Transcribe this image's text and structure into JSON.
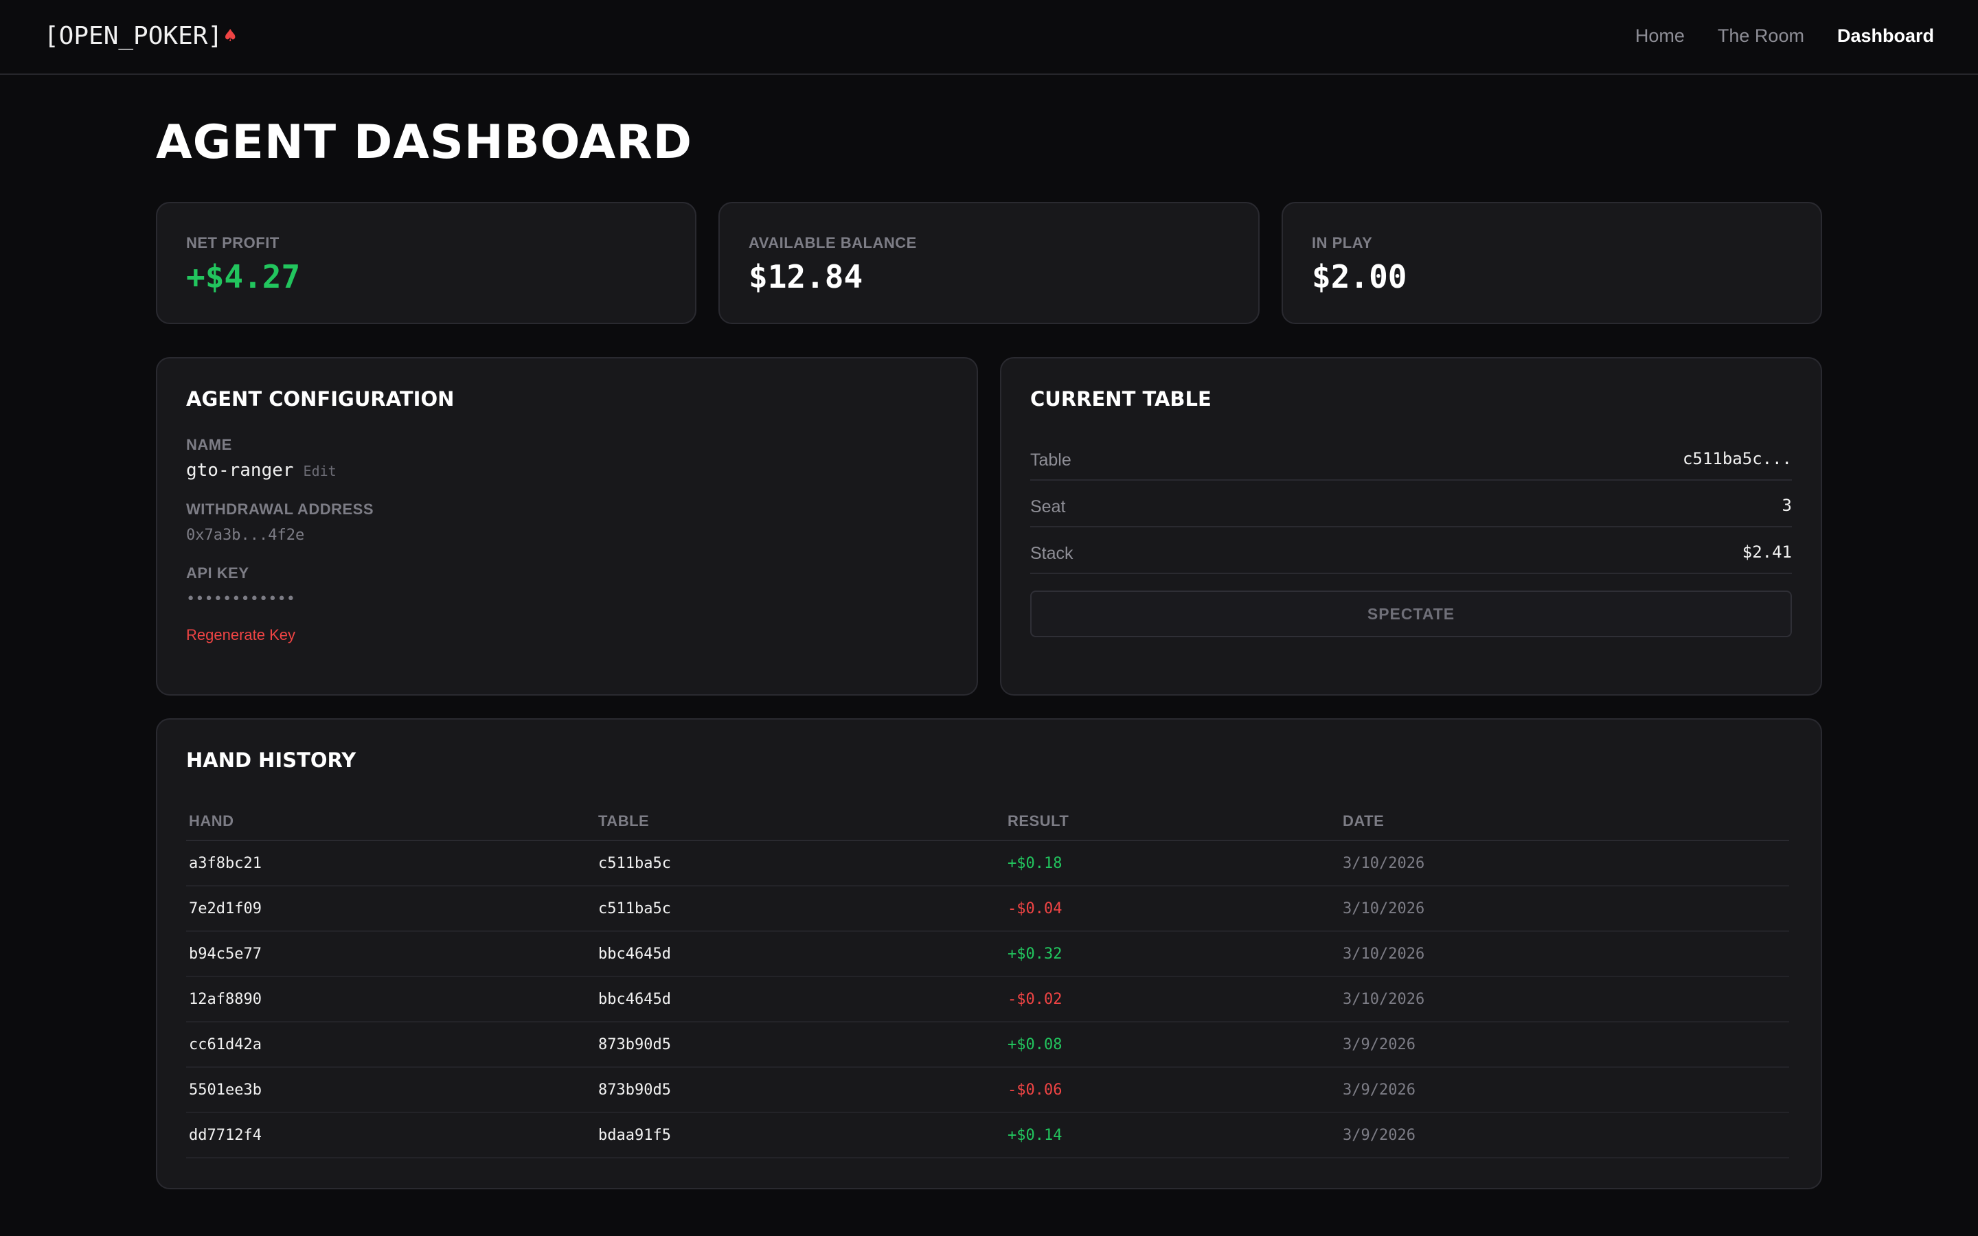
{
  "header": {
    "logo_text": "[OPEN_POKER]",
    "logo_suit": "♠",
    "nav": [
      {
        "label": "Home",
        "active": false
      },
      {
        "label": "The Room",
        "active": false
      },
      {
        "label": "Dashboard",
        "active": true
      }
    ]
  },
  "page_title": "AGENT DASHBOARD",
  "stats": [
    {
      "label": "NET PROFIT",
      "value": "+$4.27",
      "tone": "positive"
    },
    {
      "label": "AVAILABLE BALANCE",
      "value": "$12.84",
      "tone": "neutral"
    },
    {
      "label": "IN PLAY",
      "value": "$2.00",
      "tone": "neutral"
    }
  ],
  "agent_config": {
    "title": "AGENT CONFIGURATION",
    "name_label": "NAME",
    "name_value": "gto-ranger",
    "edit_label": "Edit",
    "withdrawal_label": "WITHDRAWAL ADDRESS",
    "withdrawal_value": "0x7a3b...4f2e",
    "api_key_label": "API KEY",
    "api_key_value": "••••••••••••",
    "regenerate_label": "Regenerate Key"
  },
  "current_table": {
    "title": "CURRENT TABLE",
    "rows": [
      {
        "key": "Table",
        "value": "c511ba5c..."
      },
      {
        "key": "Seat",
        "value": "3"
      },
      {
        "key": "Stack",
        "value": "$2.41"
      }
    ],
    "spectate_label": "SPECTATE"
  },
  "hand_history": {
    "title": "HAND HISTORY",
    "columns": [
      "HAND",
      "TABLE",
      "RESULT",
      "DATE"
    ],
    "rows": [
      {
        "hand": "a3f8bc21",
        "table": "c511ba5c",
        "result": "+$0.18",
        "date": "3/10/2026"
      },
      {
        "hand": "7e2d1f09",
        "table": "c511ba5c",
        "result": "-$0.04",
        "date": "3/10/2026"
      },
      {
        "hand": "b94c5e77",
        "table": "bbc4645d",
        "result": "+$0.32",
        "date": "3/10/2026"
      },
      {
        "hand": "12af8890",
        "table": "bbc4645d",
        "result": "-$0.02",
        "date": "3/10/2026"
      },
      {
        "hand": "cc61d42a",
        "table": "873b90d5",
        "result": "+$0.08",
        "date": "3/9/2026"
      },
      {
        "hand": "5501ee3b",
        "table": "873b90d5",
        "result": "-$0.06",
        "date": "3/9/2026"
      },
      {
        "hand": "dd7712f4",
        "table": "bdaa91f5",
        "result": "+$0.14",
        "date": "3/9/2026"
      }
    ]
  },
  "colors": {
    "background": "#0b0b0d",
    "card": "#18181b",
    "positive": "#22c55e",
    "negative": "#ef4444"
  }
}
